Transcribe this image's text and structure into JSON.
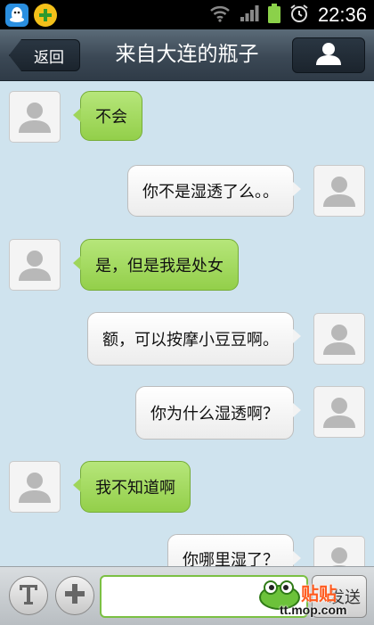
{
  "status_bar": {
    "time": "22:36",
    "icons": [
      "qq-icon",
      "guard-icon",
      "wifi-icon",
      "signal-icon",
      "battery-icon",
      "alarm-icon"
    ]
  },
  "header": {
    "back_label": "返回",
    "title": "来自大连的瓶子",
    "profile_icon": "person-icon"
  },
  "messages": [
    {
      "side": "in",
      "text": "不会"
    },
    {
      "side": "out",
      "text": "你不是湿透了么。。"
    },
    {
      "side": "in",
      "text": "是，但是我是处女"
    },
    {
      "side": "out",
      "text": "额，可以按摩小豆豆啊。"
    },
    {
      "side": "out",
      "text": "你为什么湿透啊？"
    },
    {
      "side": "in",
      "text": "我不知道啊"
    },
    {
      "side": "out",
      "text": "你哪里湿了？"
    }
  ],
  "input_bar": {
    "text_mode_icon": "text-mode-icon",
    "add_icon": "plus-icon",
    "input_value": "",
    "send_label": "发送"
  },
  "watermark": {
    "line1": "贴贴",
    "line2": "tt.mop.com"
  },
  "colors": {
    "chat_background": "#cfe3ee",
    "incoming_bubble": "#9fd55a",
    "outgoing_bubble": "#f3f3f3",
    "header": "#3b4855"
  }
}
